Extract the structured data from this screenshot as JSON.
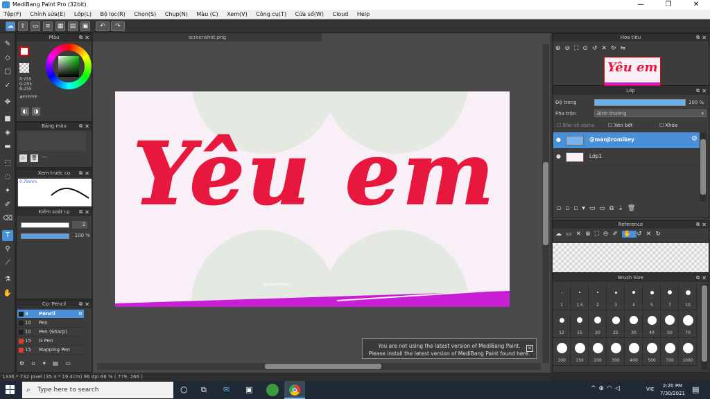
{
  "window": {
    "title": "MediBang Paint Pro (32bit)",
    "controls": [
      "—",
      "❐",
      "✕"
    ]
  },
  "menu": [
    "Tệp(F)",
    "Chỉnh sửa(E)",
    "Lớp(L)",
    "Bộ lọc(R)",
    "Chọn(S)",
    "Chụp(N)",
    "Màu (C)",
    "Xem(V)",
    "Công cụ(T)",
    "Cửa sổ(W)",
    "Cloud",
    "Help"
  ],
  "document": {
    "tab": "screenshot.png"
  },
  "color_panel": {
    "title": "Màu",
    "rgb": [
      "R:255",
      "G:255",
      "B:255"
    ],
    "hex": "#FFFFFF"
  },
  "palette_panel": {
    "title": "Bảng màu",
    "footer": "---"
  },
  "preview_panel": {
    "title": "Xem trước cọ",
    "size": "0.79mm"
  },
  "brush_control": {
    "title": "Kiểm soát cọ",
    "size_value": "3",
    "opacity_value": "100 %"
  },
  "brush_list": {
    "title": "Cọ: Pencil",
    "items": [
      {
        "size": "3",
        "name": "Pencil",
        "selected": true
      },
      {
        "size": "10",
        "name": "Pen"
      },
      {
        "size": "10",
        "name": "Pen (Sharp)"
      },
      {
        "size": "15",
        "name": "G Pen"
      },
      {
        "size": "15",
        "name": "Mapping Pen"
      }
    ]
  },
  "navigator": {
    "title": "Hoa tiêu"
  },
  "layer_panel": {
    "title": "Lớp",
    "opacity_label": "Độ trong",
    "opacity_value": "100 %",
    "blend_label": "Pha trộn",
    "blend_value": "Bình thường",
    "protect_alpha": "Bảo vệ alpha",
    "clipping": "Xén bớt",
    "lock": "Khóa",
    "layers": [
      {
        "name": "@manjiromikey",
        "selected": true
      },
      {
        "name": "Lớp1",
        "selected": false
      }
    ]
  },
  "reference_panel": {
    "title": "Reference"
  },
  "brush_size_panel": {
    "title": "Brush Size",
    "sizes": [
      "1",
      "1.5",
      "2",
      "3",
      "4",
      "5",
      "7",
      "10",
      "12",
      "15",
      "20",
      "25",
      "30",
      "40",
      "50",
      "70",
      "100",
      "150",
      "200",
      "300",
      "400",
      "500",
      "700",
      "1000"
    ]
  },
  "canvas_text": {
    "main": "Yêu em",
    "watermark": "@manjiromikey"
  },
  "notice": {
    "line1": "You are not using the latest version of MediBang Paint.",
    "line2": "Please install the latest version of MediBang Paint found here."
  },
  "status": {
    "text": "1336 * 732 pixel  (35.3 * 19.4cm)  96 dpi  66 %  ( 779, 266 )"
  },
  "taskbar": {
    "search_placeholder": "Type here to search",
    "lang": "VIE",
    "time": "2:20 PM",
    "date": "7/30/2021"
  },
  "colors": {
    "accent": "#4a90d9",
    "lettering": "#e8173e",
    "canvas_bg": "#f8f0f6",
    "stripe": "#c81fd6"
  }
}
